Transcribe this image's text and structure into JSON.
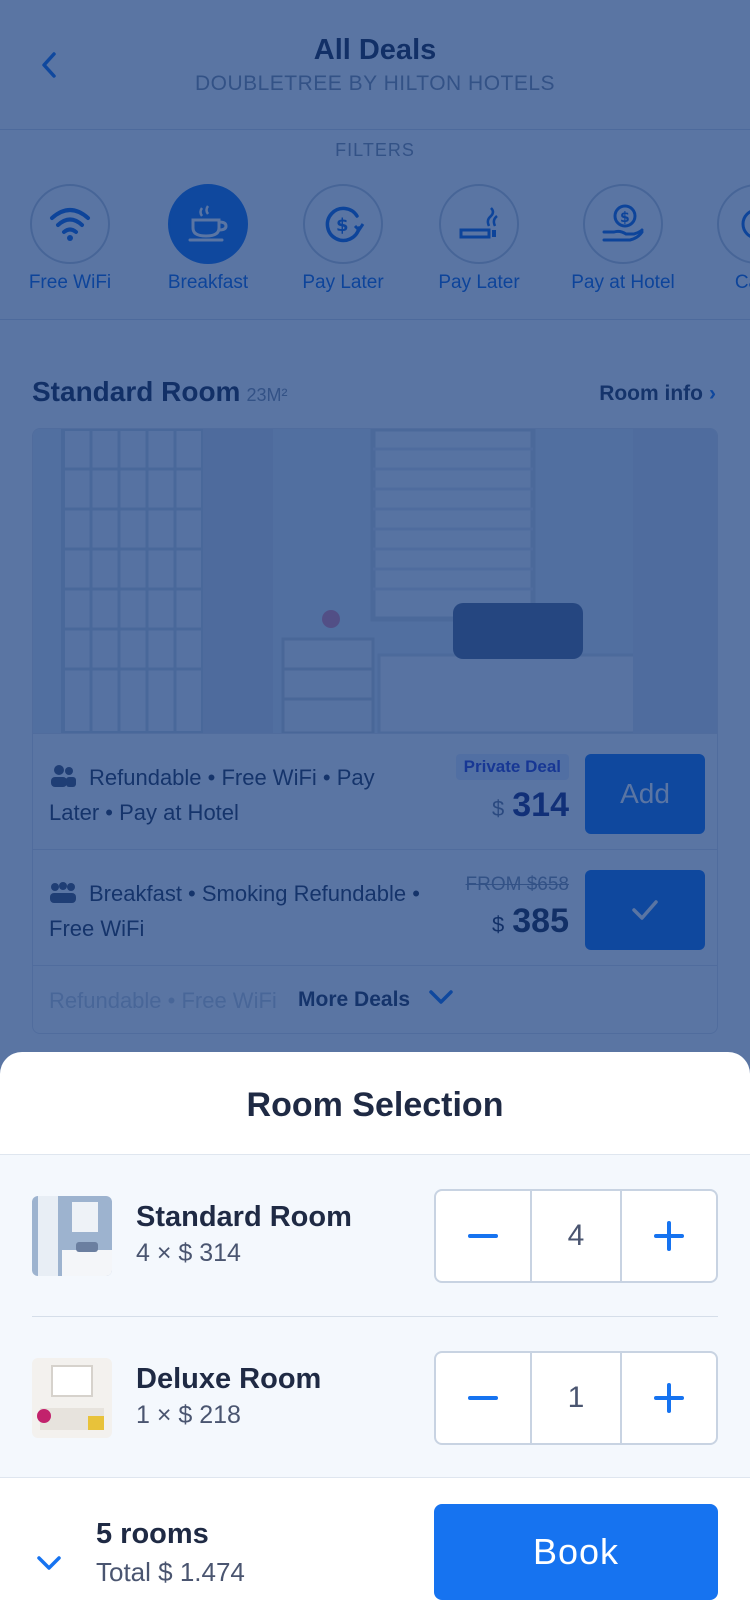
{
  "header": {
    "title": "All Deals",
    "subtitle": "DOUBLETREE BY HILTON HOTELS",
    "back_icon": "chevron-left-icon"
  },
  "filters": {
    "label": "FILTERS",
    "items": [
      {
        "label": "Free WiFi",
        "icon": "wifi-icon",
        "active": false
      },
      {
        "label": "Breakfast",
        "icon": "coffee-cup-icon",
        "active": true
      },
      {
        "label": "Pay Later",
        "icon": "dollar-refresh-icon",
        "active": false
      },
      {
        "label": "Pay Later",
        "icon": "smoking-icon",
        "active": false
      },
      {
        "label": "Pay at Hotel",
        "icon": "hand-dollar-icon",
        "active": false
      },
      {
        "label": "Canc",
        "icon": "cancel-icon",
        "active": false
      }
    ]
  },
  "room": {
    "title": "Standard Room",
    "size": "23M²",
    "info_link": "Room info",
    "deals": [
      {
        "features": "Refundable • Free WiFi • Pay Later • Pay at Hotel",
        "badge": "Private Deal",
        "currency": "$",
        "price": "314",
        "button": "Add",
        "icon": "people-icon"
      },
      {
        "features": "Breakfast • Smoking Refundable • Free WiFi",
        "from": "FROM $658",
        "currency": "$",
        "price": "385",
        "icon": "group-icon"
      }
    ],
    "more_deals": "More Deals",
    "more_faded": "Refundable • Free WiFi"
  },
  "sheet": {
    "title": "Room Selection",
    "rooms": [
      {
        "name": "Standard Room",
        "price": "4 × $ 314",
        "quantity": "4"
      },
      {
        "name": "Deluxe Room",
        "price": "1 × $ 218",
        "quantity": "1"
      }
    ],
    "summary": {
      "rooms": "5 rooms",
      "total": "Total $ 1.474"
    },
    "book": "Book"
  },
  "colors": {
    "accent": "#1673f0",
    "overlay": "#0c3478",
    "text": "#1f2a44"
  }
}
